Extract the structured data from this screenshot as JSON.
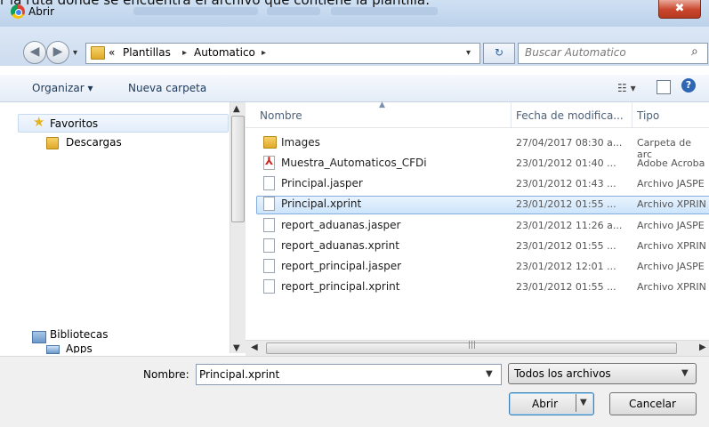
{
  "top_caption": "r la ruta donde se encuentra el archivo que contiene la plantilla:",
  "window": {
    "title": "Abrir",
    "close_glyph": "✖"
  },
  "address": {
    "breadcrumb_prefix": "«",
    "crumbs": [
      "Plantillas",
      "Automatico"
    ],
    "separator": "▸",
    "dropdown_glyph": "▾",
    "refresh_glyph": "↻",
    "search_placeholder": "Buscar Automatico",
    "search_glyph": "⌕"
  },
  "toolbar": {
    "organize": "Organizar ▾",
    "new_folder": "Nueva carpeta",
    "view_glyph": "☷ ▾",
    "help_glyph": "?"
  },
  "nav": {
    "favorites": "Favoritos",
    "downloads": "Descargas",
    "libraries": "Bibliotecas",
    "apps": "Apps"
  },
  "columns": {
    "name": "Nombre",
    "date": "Fecha de modifica...",
    "type": "Tipo"
  },
  "files": [
    {
      "name": "Images",
      "date": "27/04/2017 08:30 a...",
      "type": "Carpeta de arc",
      "icon": "folder-icon"
    },
    {
      "name": "Muestra_Automaticos_CFDi",
      "date": "23/01/2012 01:40 ...",
      "type": "Adobe Acroba",
      "icon": "pdf-file-icon"
    },
    {
      "name": "Principal.jasper",
      "date": "23/01/2012 01:43 ...",
      "type": "Archivo JASPE",
      "icon": "file-icon"
    },
    {
      "name": "Principal.xprint",
      "date": "23/01/2012 01:55 ...",
      "type": "Archivo XPRIN",
      "icon": "file-icon",
      "selected": true
    },
    {
      "name": "report_aduanas.jasper",
      "date": "23/01/2012 11:26 a...",
      "type": "Archivo JASPE",
      "icon": "file-icon"
    },
    {
      "name": "report_aduanas.xprint",
      "date": "23/01/2012 01:55 ...",
      "type": "Archivo XPRIN",
      "icon": "file-icon"
    },
    {
      "name": "report_principal.jasper",
      "date": "23/01/2012 12:01 ...",
      "type": "Archivo JASPE",
      "icon": "file-icon"
    },
    {
      "name": "report_principal.xprint",
      "date": "23/01/2012 01:55 ...",
      "type": "Archivo XPRIN",
      "icon": "file-icon"
    }
  ],
  "bottom": {
    "filename_label": "Nombre:",
    "filename_value": "Principal.xprint",
    "filetype": "Todos los archivos",
    "open": "Abrir",
    "cancel": "Cancelar"
  },
  "colors": {
    "selection": "#cce4fb",
    "titlebar": "#bcd2ea",
    "close": "#c9462c"
  }
}
